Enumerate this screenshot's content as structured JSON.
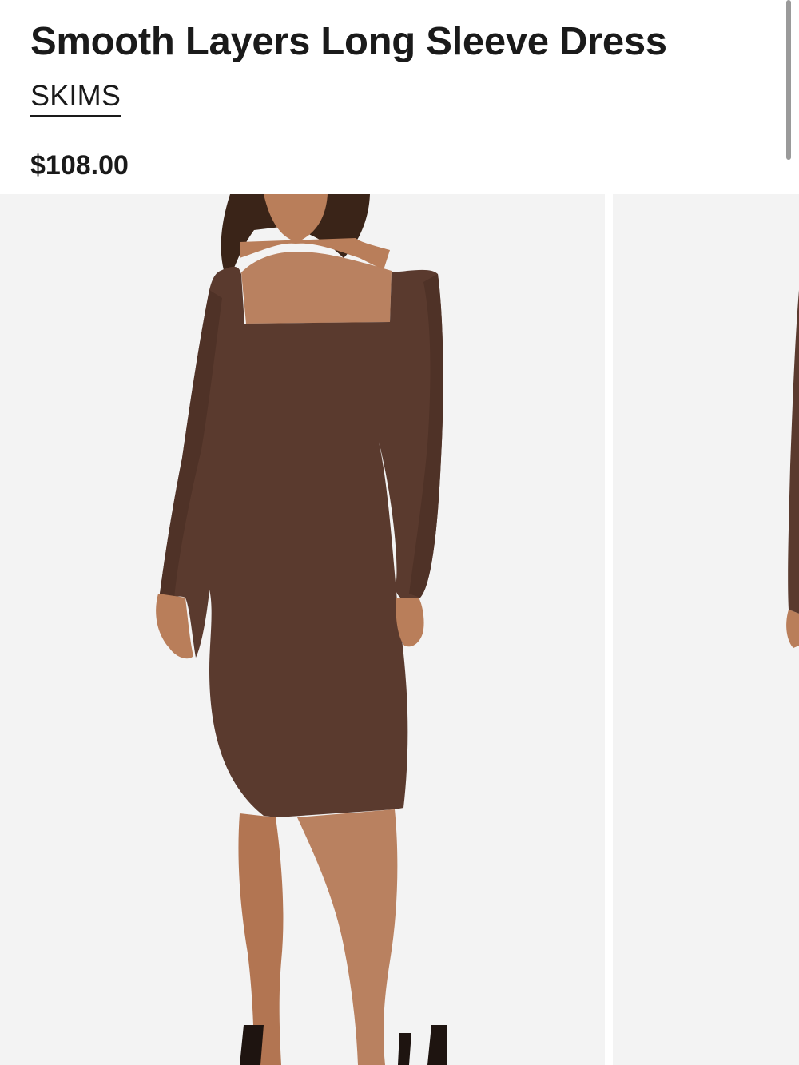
{
  "product": {
    "title": "Smooth Layers Long Sleeve Dress",
    "brand": "SKIMS",
    "price": "$108.00"
  },
  "gallery": {
    "images": [
      {
        "icon": "dress-photo-icon",
        "dress_color": "#5a3a2e",
        "skin_color": "#b97e5a",
        "hair_color": "#3a2418",
        "background": "#f3f3f3"
      },
      {
        "icon": "dress-photo-icon",
        "background": "#f3f3f3"
      }
    ]
  },
  "colors": {
    "text": "#1a1a1a",
    "scrollbar": "#9a9a9a"
  }
}
